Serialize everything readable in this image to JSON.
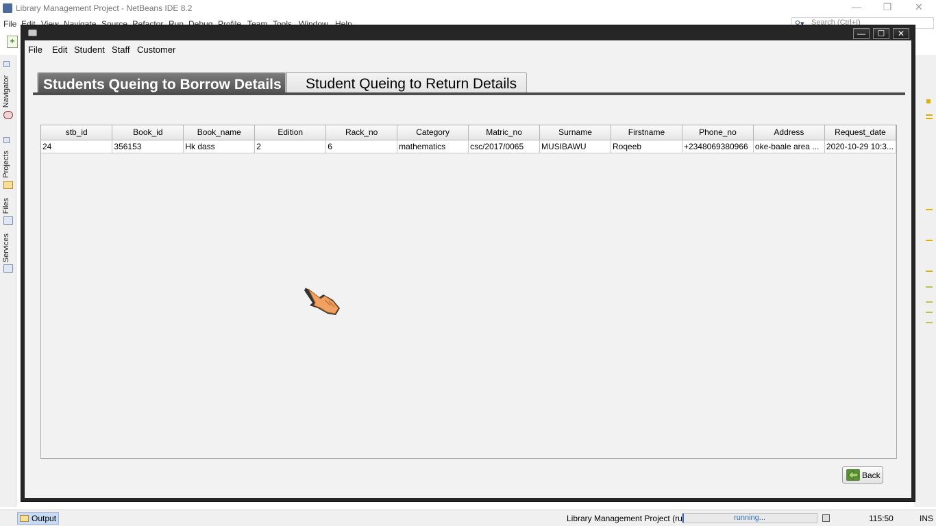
{
  "ide": {
    "title": "Library Management Project - NetBeans IDE 8.2",
    "menu": [
      "File",
      "Edit",
      "View",
      "Navigate",
      "Source",
      "Refactor",
      "Run",
      "Debug",
      "Profile",
      "Team",
      "Tools",
      "Window",
      "Help"
    ],
    "search_placeholder": "Search (Ctrl+I)",
    "side_tabs": [
      "Navigator",
      "Projects",
      "Files",
      "Services"
    ],
    "status": {
      "output_tab": "Output",
      "run_label": "Library Management Project (run)",
      "progress_text": "running...",
      "caret_position": "115:50",
      "insert_mode": "INS"
    }
  },
  "app": {
    "menu": [
      "File",
      "Edit",
      "Student",
      "Staff",
      "Customer"
    ],
    "tabs": [
      {
        "label": "Students Queing to Borrow Details",
        "selected": true
      },
      {
        "label": "Student Queing to Return Details",
        "selected": false
      }
    ],
    "table": {
      "columns": [
        "stb_id",
        "Book_id",
        "Book_name",
        "Edition",
        "Rack_no",
        "Category",
        "Matric_no",
        "Surname",
        "Firstname",
        "Phone_no",
        "Address",
        "Request_date"
      ],
      "rows": [
        [
          "24",
          "356153",
          "Hk dass",
          "2",
          "6",
          "mathematics",
          "csc/2017/0065",
          "MUSIBAWU",
          "Roqeeb",
          "+2348069380966",
          "oke-baale area ...",
          "2020-10-29 10:3..."
        ]
      ]
    },
    "back_button": "Back"
  },
  "colors": {
    "window_frame": "#262626",
    "selected_tab": "#5f5f5f",
    "progress_text": "#2c6dbf"
  }
}
